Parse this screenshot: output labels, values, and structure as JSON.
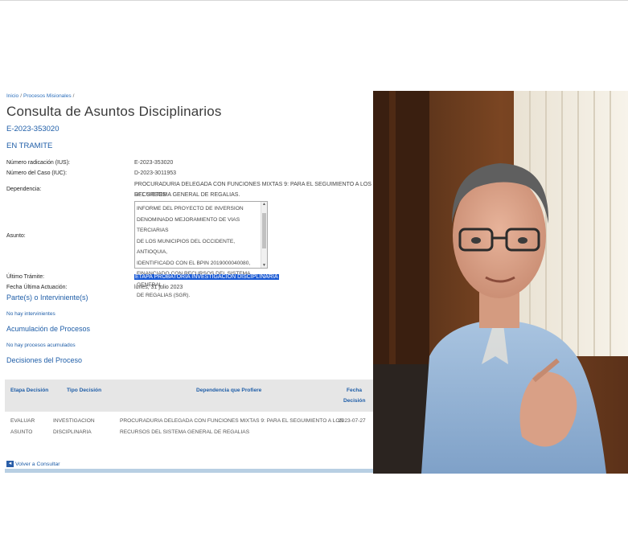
{
  "breadcrumb": {
    "home": "Inicio",
    "section": "Procesos Misionales"
  },
  "page_title": "Consulta de Asuntos Disciplinarios",
  "case_number": "E-2023-353020",
  "status": "EN TRAMITE",
  "fields": {
    "radicacion_label": "Número radicación (IUS):",
    "radicacion_value": "E-2023-353020",
    "caso_label": "Número del Caso (IUC):",
    "caso_value": "D-2023-3011953",
    "dependencia_label": "Dependencia:",
    "dependencia_value_1": "PROCURADURIA DELEGADA CON FUNCIONES MIXTAS 9: PARA EL SEGUIMIENTO A LOS RECURSOS",
    "dependencia_value_2": "DEL SISTEMA GENERAL DE REGALIAS.",
    "asunto_label": "Asunto:",
    "asunto_lines": [
      "INFORME DEL PROYECTO DE INVERSION",
      "DENOMINADO MEJORAMIENTO DE VIAS TERCIARIAS",
      "DE LOS MUNICIPIOS DEL OCCIDENTE, ANTIOQUIA,",
      "IDENTIFICADO CON EL BPIN 2019000040080,",
      "FINANCIADO CON RECURSOS DEL SISTEMA GENERAL",
      "DE REGALIAS (SGR)."
    ],
    "ultimo_tramite_label": "Último Trámite:",
    "ultimo_tramite_value": "ETAPA PROBATORIA INVESTIGACION DISCIPLINARIA",
    "fecha_label": "Fecha Última Actuación:",
    "fecha_value": "lunes, 31 julio 2023"
  },
  "sections": {
    "partes_title": "Parte(s) o Interviniente(s)",
    "partes_note": "No hay intervinientes",
    "acumulacion_title": "Acumulación de Procesos",
    "acumulacion_note": "No hay procesos acumulados",
    "decisiones_title": "Decisiones del Proceso"
  },
  "table": {
    "headers": [
      "Etapa Decisión",
      "Tipo Decisión",
      "Dependencia que Profiere",
      "Fecha",
      "Decisión"
    ],
    "row": {
      "etapa_1": "EVALUAR",
      "etapa_2": "ASUNTO",
      "tipo_1": "INVESTIGACION",
      "tipo_2": "DISCIPLINARIA",
      "dep_1": "PROCURADURIA DELEGADA CON FUNCIONES MIXTAS 9: PARA EL SEGUIMIENTO A LOS",
      "dep_2": "RECURSOS DEL SISTEMA GENERAL DE REGALIAS",
      "fecha": "2023-07-27"
    }
  },
  "back_link": "Volver a Consultar",
  "colors": {
    "link": "#1f5ea8",
    "highlight": "#1c5bd4",
    "table_header_bg": "#e6e6e6"
  }
}
